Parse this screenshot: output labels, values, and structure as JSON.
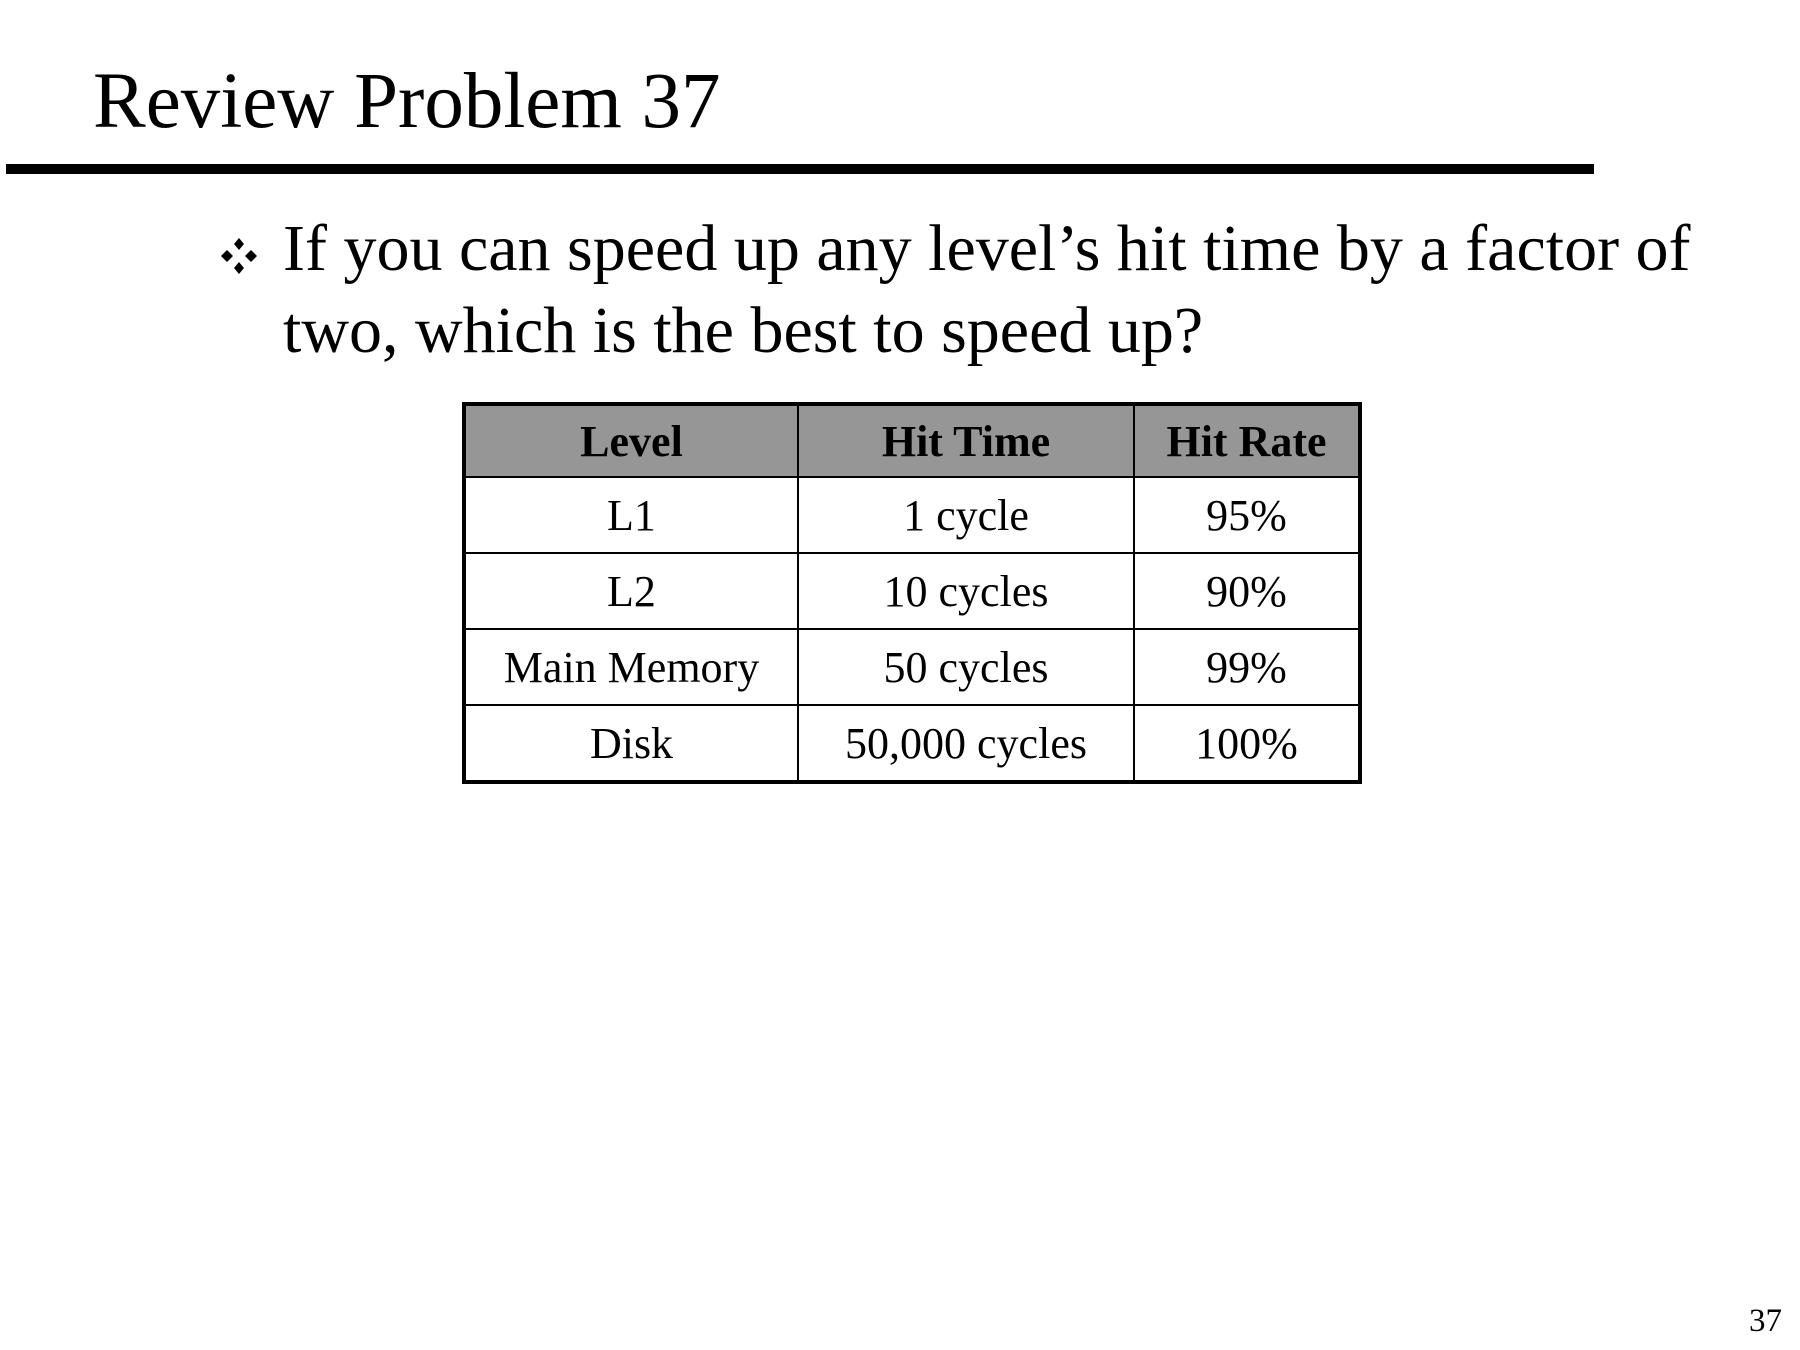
{
  "slide": {
    "title": "Review Problem 37",
    "bullet_icon": "diamond-cluster-icon",
    "bullet_text": "If you can speed up any level’s hit time by a factor of two, which is the best to speed up?",
    "page_number": "37"
  },
  "table": {
    "headers": [
      "Level",
      "Hit Time",
      "Hit Rate"
    ],
    "header_color": "#969696",
    "rows": [
      [
        "L1",
        "1 cycle",
        "95%"
      ],
      [
        "L2",
        "10 cycles",
        "90%"
      ],
      [
        "Main Memory",
        "50 cycles",
        "99%"
      ],
      [
        "Disk",
        "50,000 cycles",
        "100%"
      ]
    ]
  }
}
